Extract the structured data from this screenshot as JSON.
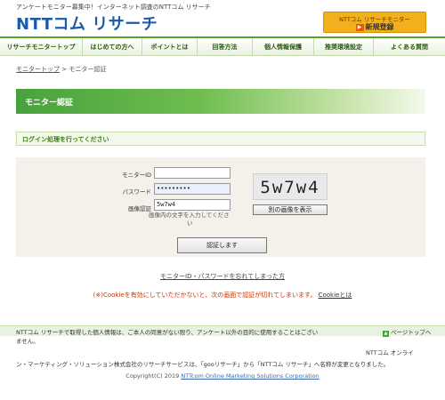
{
  "header": {
    "tagline": "アンケートモニター募集中！インターネット調査のNTTコム リサーチ",
    "logo": "NTTコム リサーチ",
    "register_top": "NTTコム リサーチモニター",
    "register_label": "新規登録"
  },
  "nav": {
    "items": [
      "リサーチモニタートップ",
      "はじめての方へ",
      "ポイントとは",
      "回答方法",
      "個人情報保護",
      "推奨環境設定",
      "よくある質問"
    ]
  },
  "breadcrumb": {
    "home": "モニタートップ",
    "sep": ">",
    "current": "モニター認証"
  },
  "banner_title": "モニター認証",
  "status_message": "ログイン処理を行ってください",
  "form": {
    "id_label": "モニターID",
    "id_value": "",
    "password_label": "パスワード",
    "password_value": "•••••••••",
    "captcha_label": "画像認証",
    "captcha_value": "5w7w4",
    "captcha_hint_1": "画像内の文字を入力してくださ",
    "captcha_hint_2": "い",
    "captcha_image_text": "5w7w4",
    "other_image_button": "別の画像を表示",
    "submit_button": "認証します"
  },
  "forgot_link": "モニターID・パスワードを忘れてしまった方",
  "cookie": {
    "notice": "(※)Cookieを有効にしていただかないと、次の画面で認証が切れてしまいます。",
    "link": "Cookieとは"
  },
  "footer": {
    "page_top": "ページトップへ",
    "privacy_1": "NTTコム リサーチで取得した個人情報は、ご本人の同意がない限り、アンケート以外の目的に使用することはござい",
    "privacy_2": "ません。",
    "ntt_side": "NTTコム オンライ",
    "rename": "ン・マーケティング・ソリューション株式会社のリサーチサービスは、「gooリサーチ」から「NTTコム リサーチ」へ名称が変更となりました。",
    "copyright_prefix": "Copyright(C) 2019",
    "copyright_link": "NTTcom Online Marketing Solutions Corporation"
  },
  "colors": {
    "brand_blue": "#1b5aa8",
    "green": "#48a23c",
    "orange": "#f2b01e",
    "warning": "#cc3300"
  }
}
